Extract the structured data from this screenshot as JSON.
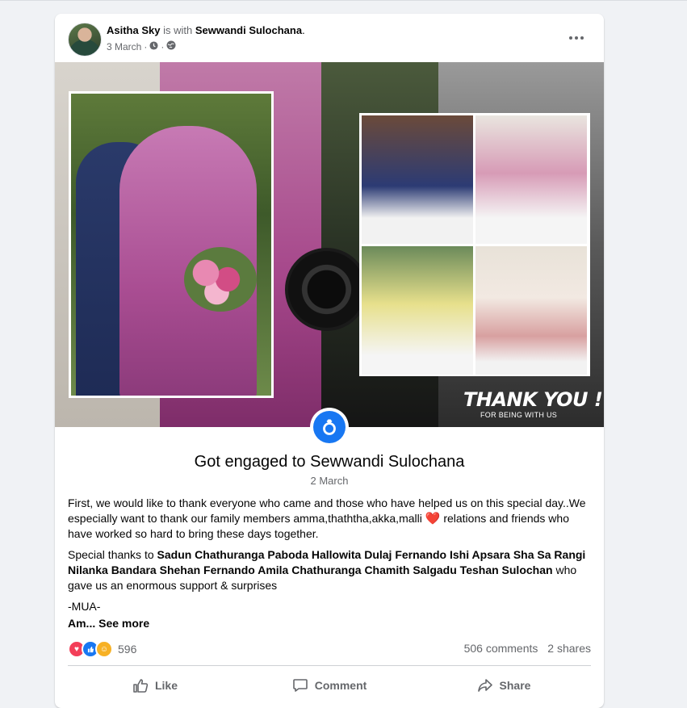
{
  "post": {
    "author": "Asitha Sky",
    "with_text": "is with",
    "tagged": "Sewwandi Sulochana",
    "tagged_suffix": ".",
    "date": "3 March",
    "separator": "·",
    "audience_icon": "globe-icon",
    "more_icon": "more-options-icon"
  },
  "photo": {
    "overlay_text": "THANK YOU !",
    "overlay_sub": "FOR BEING WITH US"
  },
  "life_event": {
    "icon": "ring-icon",
    "title": "Got engaged to Sewwandi Sulochana",
    "date": "2 March"
  },
  "body": {
    "p1": "First, we would like to thank everyone who came and those who have helped us on this special day..We especially want to thank our family members amma,thaththa,akka,malli",
    "p1_emoji": "❤️",
    "p1_end": " relations and friends who have worked so hard to bring these days together.",
    "p2_start": "Special thanks to ",
    "p2_names": "Sadun Chathuranga Paboda Hallowita Dulaj Fernando Ishi Apsara Sha Sa Rangi Nilanka Bandara Shehan Fernando Amila Chathuranga Chamith Salgadu Teshan Sulochan",
    "p2_end": " who gave us an enormous support & surprises",
    "p3": "-MUA-",
    "p4_start": "Am...",
    "see_more": " See more"
  },
  "stats": {
    "reactions_count": "596",
    "comments": "506 comments",
    "shares": "2 shares"
  },
  "actions": {
    "like": "Like",
    "comment": "Comment",
    "share": "Share"
  },
  "colors": {
    "accent": "#1877f2",
    "secondary_text": "#65676b",
    "background": "#f0f2f5"
  }
}
